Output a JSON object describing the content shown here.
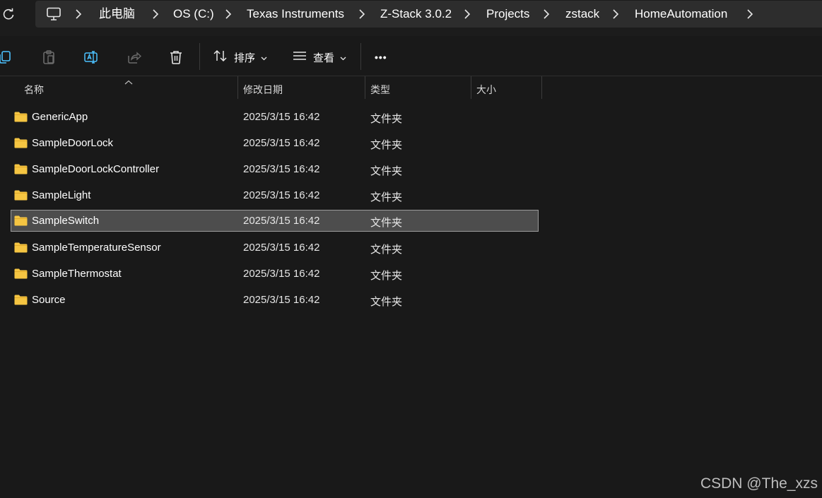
{
  "address_bar": {
    "crumbs": [
      "此电脑",
      "OS (C:)",
      "Texas Instruments",
      "Z-Stack 3.0.2",
      "Projects",
      "zstack",
      "HomeAutomation"
    ]
  },
  "toolbar": {
    "sort_label": "排序",
    "view_label": "查看",
    "more_label": "•••"
  },
  "columns": {
    "name": "名称",
    "modified": "修改日期",
    "type": "类型",
    "size": "大小"
  },
  "files": [
    {
      "name": "GenericApp",
      "modified": "2025/3/15 16:42",
      "type": "文件夹"
    },
    {
      "name": "SampleDoorLock",
      "modified": "2025/3/15 16:42",
      "type": "文件夹"
    },
    {
      "name": "SampleDoorLockController",
      "modified": "2025/3/15 16:42",
      "type": "文件夹"
    },
    {
      "name": "SampleLight",
      "modified": "2025/3/15 16:42",
      "type": "文件夹"
    },
    {
      "name": "SampleSwitch",
      "modified": "2025/3/15 16:42",
      "type": "文件夹",
      "selected": true
    },
    {
      "name": "SampleTemperatureSensor",
      "modified": "2025/3/15 16:42",
      "type": "文件夹"
    },
    {
      "name": "SampleThermostat",
      "modified": "2025/3/15 16:42",
      "type": "文件夹"
    },
    {
      "name": "Source",
      "modified": "2025/3/15 16:42",
      "type": "文件夹"
    }
  ],
  "watermark": "CSDN @The_xzs",
  "colors": {
    "folder": "#f5c542",
    "selection_bg": "#4d4d4d",
    "accent": "#4cc2ff"
  }
}
